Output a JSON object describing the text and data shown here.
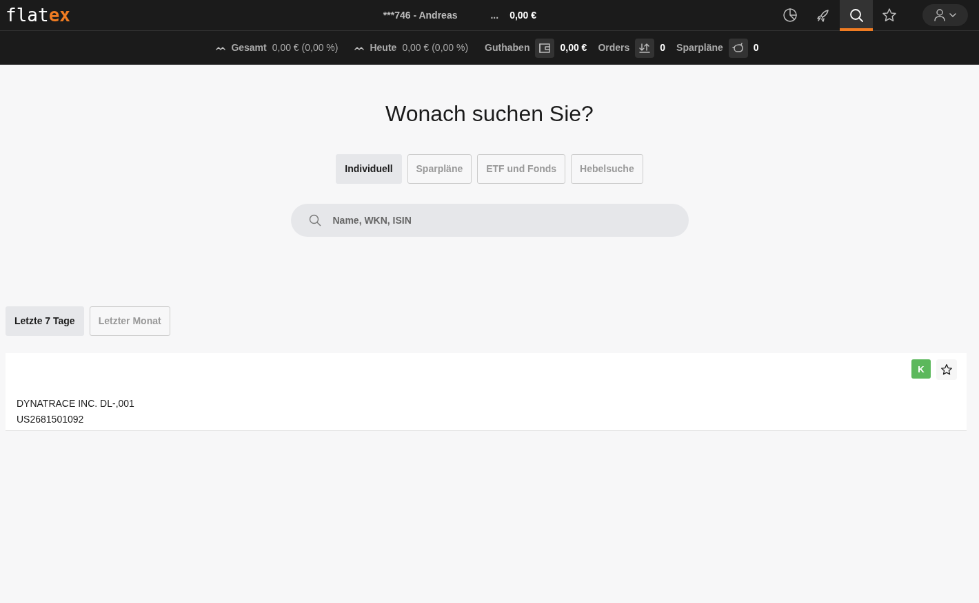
{
  "logo": {
    "main": "flat",
    "accent": "ex"
  },
  "account": {
    "label": "***746 - Andreas",
    "dots": "...",
    "balance": "0,00 €"
  },
  "nav_icons": [
    {
      "kind": "chart",
      "selected": false
    },
    {
      "kind": "rocket",
      "selected": false
    },
    {
      "kind": "search",
      "selected": true
    },
    {
      "kind": "star",
      "selected": false
    }
  ],
  "summary": [
    {
      "kind": "trend",
      "label": "Gesamt",
      "value": "0,00 € (0,00 %)"
    },
    {
      "kind": "trend",
      "label": "Heute",
      "value": "0,00 € (0,00 %)"
    },
    {
      "kind": "wallet",
      "label": "Guthaben",
      "value": "0,00 €"
    },
    {
      "kind": "orders",
      "label": "Orders",
      "value": "0"
    },
    {
      "kind": "piggy",
      "label": "Sparpläne",
      "value": "0"
    }
  ],
  "heading": "Wonach suchen Sie?",
  "search_tabs": [
    {
      "label": "Individuell",
      "selected": true
    },
    {
      "label": "Sparpläne",
      "selected": false
    },
    {
      "label": "ETF und Fonds",
      "selected": false
    },
    {
      "label": "Hebelsuche",
      "selected": false
    }
  ],
  "search": {
    "placeholder": "Name, WKN, ISIN"
  },
  "period_tabs": [
    {
      "label": "Letzte 7 Tage",
      "selected": true
    },
    {
      "label": "Letzter Monat",
      "selected": false
    }
  ],
  "results": [
    {
      "name": "DYNATRACE INC. DL-,001",
      "isin": "US2681501092",
      "badge": "K",
      "color": "#5cb85c"
    }
  ]
}
